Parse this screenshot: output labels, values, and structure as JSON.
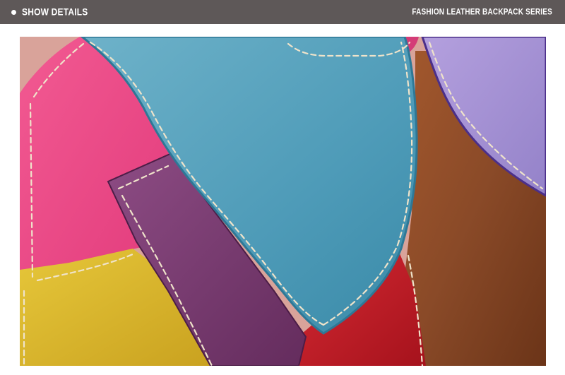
{
  "header": {
    "left_title": "SHOW DETAILS",
    "right_title": "FASHION LEATHER BACKPACK SERIES"
  },
  "colors": {
    "header_bg": "#5e5858",
    "leather_blue": "#4e9bb8",
    "leather_pink": "#ef4a86",
    "leather_purple": "#7b3d73",
    "leather_yellow": "#d8b52a",
    "leather_brown": "#8a4a28",
    "leather_red": "#c21d28",
    "leather_lavender": "#a38ed3",
    "leather_magenta": "#d43c77",
    "stitch": "#efe3ca"
  },
  "photo": {
    "subject": "patchwork-leather-closeup"
  }
}
